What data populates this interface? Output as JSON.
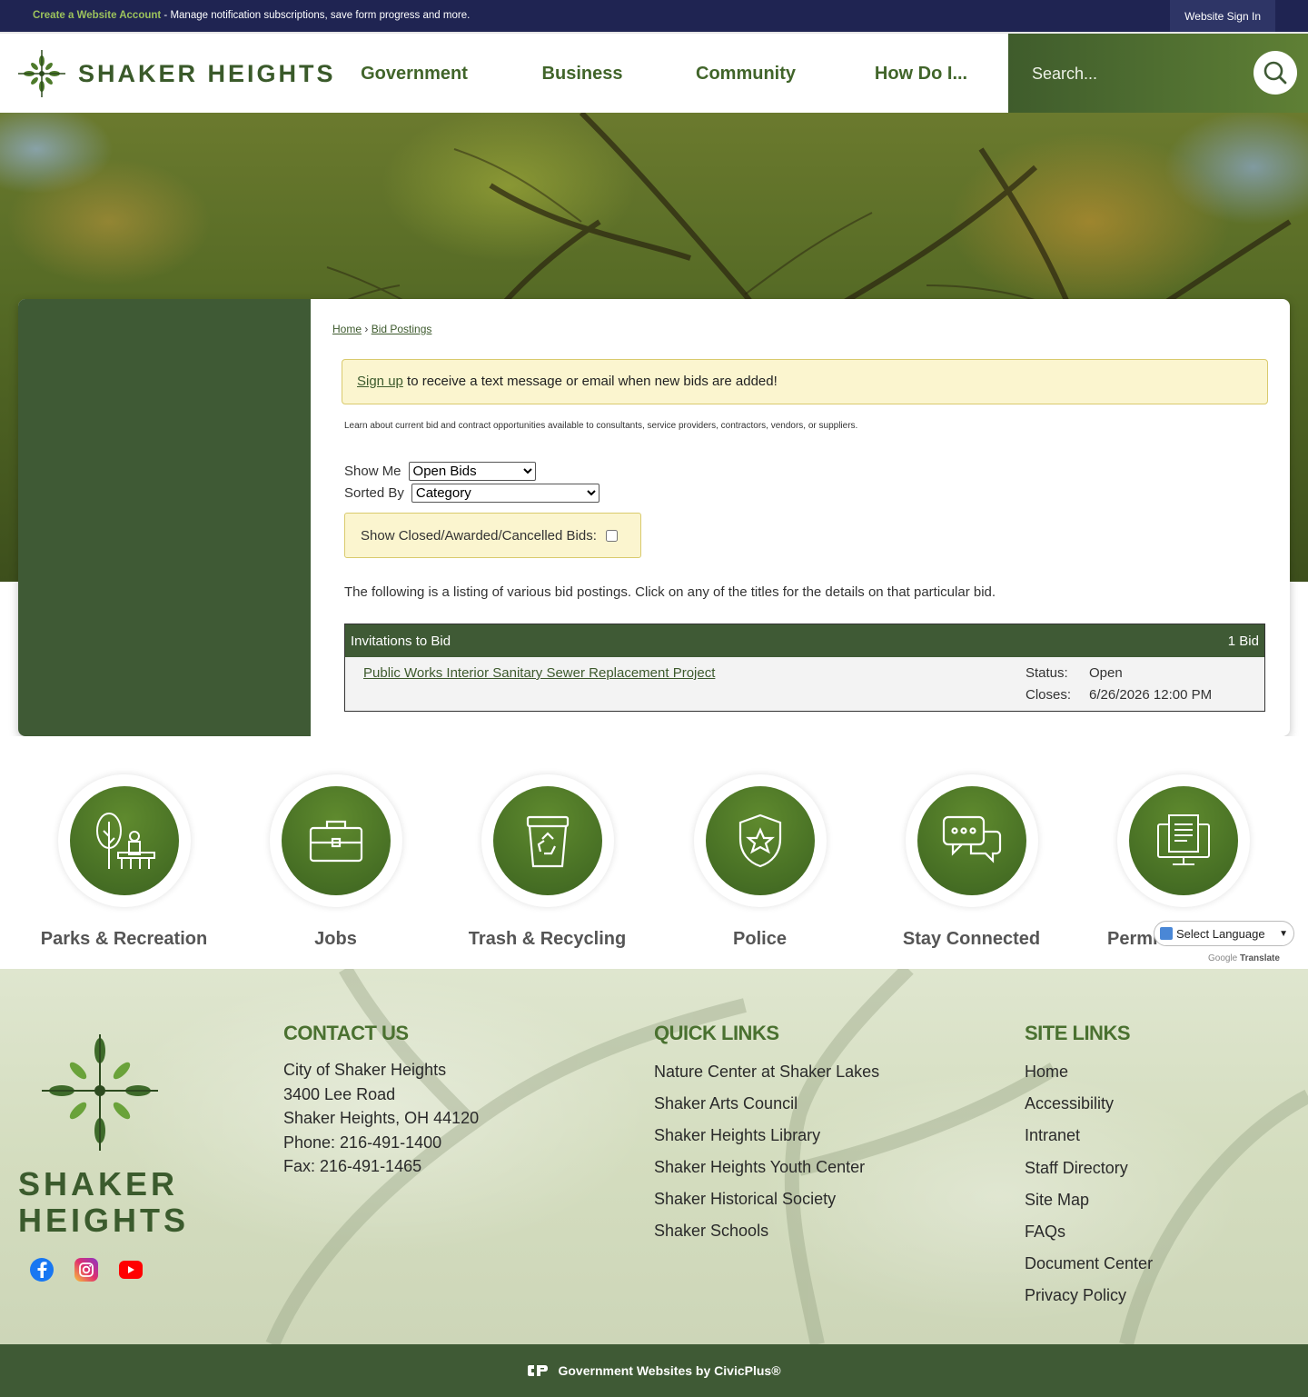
{
  "topbar": {
    "create_account": "Create a Website Account",
    "message": " - Manage notification subscriptions, save form progress and more.",
    "sign_in": "Website Sign In"
  },
  "header": {
    "logo_text": "SHAKER HEIGHTS",
    "nav": [
      "Government",
      "Business",
      "Community",
      "How Do I..."
    ],
    "search_placeholder": "Search..."
  },
  "breadcrumb": {
    "home": "Home",
    "sep": "›",
    "current": "Bid Postings"
  },
  "notice": {
    "link": "Sign up",
    "text": " to receive a text message or email when new bids are added!"
  },
  "intro": "Learn about current bid and contract opportunities available to consultants, service providers, contractors, vendors, or suppliers.",
  "filters": {
    "show_me_label": "Show Me",
    "show_me_value": "Open Bids",
    "sorted_by_label": "Sorted By",
    "sorted_by_value": "Category",
    "show_closed_label": "Show Closed/Awarded/Cancelled Bids:"
  },
  "listing_text": "The following is a listing of various bid postings. Click on any of the titles for the details on that particular bid.",
  "bids": {
    "category": "Invitations to Bid",
    "count": "1 Bid",
    "items": [
      {
        "title": "Public Works Interior Sanitary Sewer Replacement Project",
        "status_label": "Status:",
        "status": "Open",
        "closes_label": "Closes:",
        "closes": "6/26/2026 12:00 PM"
      }
    ]
  },
  "quick_links": [
    {
      "label": "Parks & Recreation",
      "icon": "park-bench-icon"
    },
    {
      "label": "Jobs",
      "icon": "briefcase-icon"
    },
    {
      "label": "Trash & Recycling",
      "icon": "recycle-bin-icon"
    },
    {
      "label": "Police",
      "icon": "police-badge-icon"
    },
    {
      "label": "Stay Connected",
      "icon": "chat-bubbles-icon"
    },
    {
      "label": "Permi",
      "icon": "computer-document-icon"
    }
  ],
  "translate": {
    "label": "Select Language",
    "powered_by": "Google",
    "powered_word": "Translate"
  },
  "footer": {
    "logo_line1": "SHAKER",
    "logo_line2": "HEIGHTS",
    "contact": {
      "heading": "CONTACT US",
      "lines": [
        "City of Shaker Heights",
        "3400 Lee Road",
        "Shaker Heights, OH 44120",
        "Phone: 216-491-1400",
        "Fax: 216-491-1465"
      ]
    },
    "quick_links": {
      "heading": "QUICK LINKS",
      "items": [
        "Nature Center at Shaker Lakes",
        "Shaker Arts Council",
        "Shaker Heights Library",
        "Shaker Heights Youth Center",
        "Shaker Historical Society",
        "Shaker Schools"
      ]
    },
    "site_links": {
      "heading": "SITE LINKS",
      "items": [
        "Home",
        "Accessibility",
        "Intranet",
        "Staff Directory",
        "Site Map",
        "FAQs",
        "Document Center",
        "Privacy Policy"
      ]
    },
    "credit": "Government Websites by CivicPlus®"
  },
  "colors": {
    "navy": "#1f2452",
    "brand_green": "#3f5a35",
    "accent_green": "#5f8a2e",
    "notice_yellow": "#fbf5cf"
  }
}
